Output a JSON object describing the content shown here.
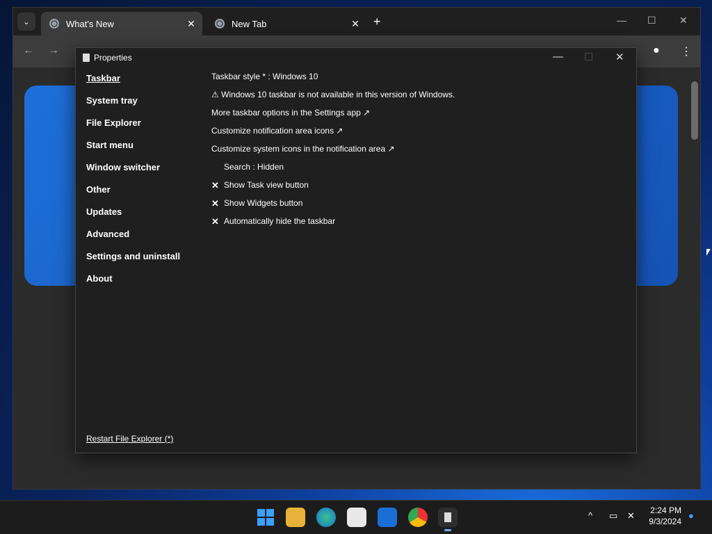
{
  "browser": {
    "tabs": [
      {
        "label": "What's New",
        "active": true
      },
      {
        "label": "New Tab",
        "active": false
      }
    ],
    "new_tab_glyph": "+",
    "close_glyph": "✕",
    "dropdown_glyph": "⌄"
  },
  "dialog": {
    "title": "Properties",
    "nav": [
      {
        "label": "Taskbar",
        "active": true
      },
      {
        "label": "System tray"
      },
      {
        "label": "File Explorer"
      },
      {
        "label": "Start menu"
      },
      {
        "label": "Window switcher"
      },
      {
        "label": "Other"
      },
      {
        "label": "Updates"
      },
      {
        "label": "Advanced"
      },
      {
        "label": "Settings and uninstall"
      },
      {
        "label": "About"
      }
    ],
    "settings": [
      {
        "text": "Taskbar style * : Windows 10",
        "mark": ""
      },
      {
        "text": "⚠ Windows 10 taskbar is not available in this version of Windows.",
        "mark": ""
      },
      {
        "text": "More taskbar options in the Settings app ↗",
        "mark": ""
      },
      {
        "text": "Customize notification area icons ↗",
        "mark": ""
      },
      {
        "text": "Customize system icons in the notification area ↗",
        "mark": ""
      },
      {
        "text": "Search : Hidden",
        "mark": "",
        "indent": true
      },
      {
        "text": "Show Task view button",
        "mark": "✕"
      },
      {
        "text": "Show Widgets button",
        "mark": "✕"
      },
      {
        "text": "Automatically hide the taskbar",
        "mark": "✕"
      }
    ],
    "restart_link": "Restart File Explorer (*)"
  },
  "taskbar": {
    "apps": [
      "windows-start-icon",
      "file-explorer-icon",
      "edge-icon",
      "store-icon",
      "outlook-icon",
      "chrome-icon",
      "explorerpatcher-icon"
    ],
    "clock_time": "2:24 PM",
    "clock_date": "9/3/2024",
    "tray_chevron": "^"
  },
  "colors": {
    "dialog_bg": "#1f1f1f",
    "taskbar_bg": "#1c1c1c",
    "accent": "#6ab0ff"
  }
}
